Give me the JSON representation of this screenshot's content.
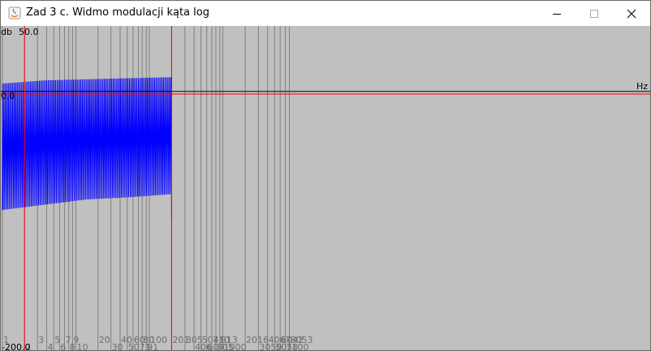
{
  "window": {
    "title": "Zad 3 c. Widmo modulacji kąta log",
    "buttons": {
      "minimize": "minimize-icon",
      "maximize": "maximize-icon",
      "close": "close-icon"
    }
  },
  "chart_data": {
    "type": "line",
    "title": "",
    "xlabel": "Hz",
    "ylabel": "db",
    "x_scale": "log",
    "ylim": [
      -200.0,
      50.0
    ],
    "y_tick_labels": [
      "50.0",
      "0.0",
      "-200.0"
    ],
    "x_tick_labels_row1": [
      "1",
      "3",
      "5",
      "7",
      "9",
      "20",
      "40",
      "60",
      "80",
      "100",
      "201",
      "305",
      "504",
      "710",
      "913",
      "2016",
      "4067",
      "6042",
      "8053"
    ],
    "x_tick_labels_row2": [
      "2",
      "4",
      "6",
      "8",
      "10",
      "30",
      "50",
      "71",
      "91",
      "406",
      "604",
      "805",
      "1000",
      "3050",
      "5058",
      "7100"
    ],
    "series": [
      {
        "color": "#0000ff",
        "x_range": [
          1,
          201
        ],
        "upper_envelope_db": [
          10,
          13,
          14,
          15,
          16
        ],
        "lower_envelope_db": [
          -110,
          -105,
          -100,
          -98,
          -95
        ]
      }
    ],
    "red_vertical_lines_hz": [
      2,
      201
    ],
    "red_horizontal_line_db": 0.0,
    "black_horizontal_line_db": 2.5,
    "grid": true,
    "colors": {
      "background": "#c0c0c0",
      "grid": "#808080",
      "axes": "#ff0000",
      "zero_line": "#000000",
      "signal": "#0000ff"
    }
  }
}
